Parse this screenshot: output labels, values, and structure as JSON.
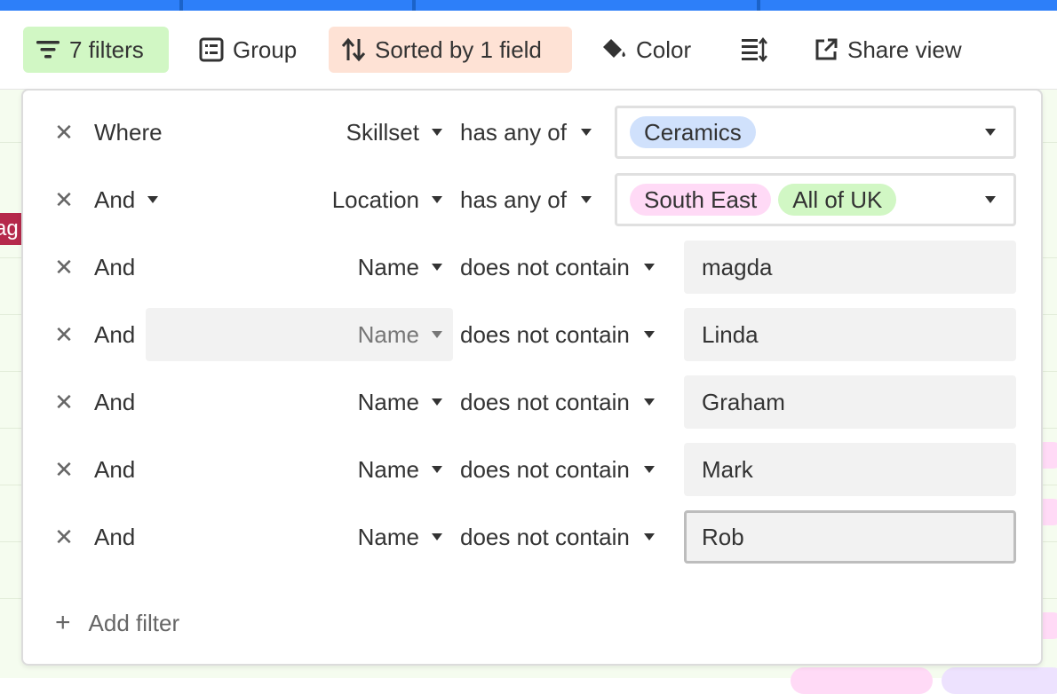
{
  "colors": {
    "filters_bg": "#d1f7c4",
    "sort_bg": "#fee2d5",
    "pill_ceramics": "#d0e1fc",
    "pill_southeast": "#ffdaf6",
    "pill_allofuk": "#d1f7c4"
  },
  "toolbar": {
    "filters_label": "7 filters",
    "group_label": "Group",
    "sort_label": "Sorted by 1 field",
    "color_label": "Color",
    "share_label": "Share view"
  },
  "background": {
    "tag_left": "ag"
  },
  "filters": [
    {
      "conjunction": "Where",
      "field": "Skillset",
      "operator": "has any of",
      "values": [
        "Ceramics"
      ]
    },
    {
      "conjunction": "And",
      "field": "Location",
      "operator": "has any of",
      "values": [
        "South East",
        "All of UK"
      ]
    },
    {
      "conjunction": "And",
      "field": "Name",
      "operator": "does not contain",
      "value": "magda"
    },
    {
      "conjunction": "And",
      "field": "Name",
      "operator": "does not contain",
      "value": "Linda"
    },
    {
      "conjunction": "And",
      "field": "Name",
      "operator": "does not contain",
      "value": "Graham"
    },
    {
      "conjunction": "And",
      "field": "Name",
      "operator": "does not contain",
      "value": "Mark"
    },
    {
      "conjunction": "And",
      "field": "Name",
      "operator": "does not contain",
      "value": "Rob"
    }
  ],
  "add_filter_label": "Add filter"
}
